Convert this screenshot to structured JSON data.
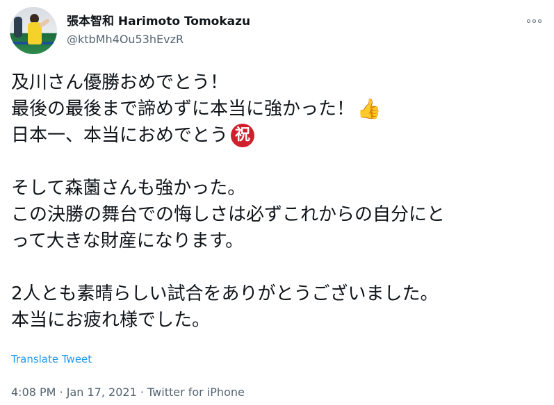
{
  "author": {
    "name": "張本智和 Harimoto Tomokazu",
    "handle": "@ktbMh4Ou53hEvzR"
  },
  "tweet": {
    "lines": [
      "及川さん優勝おめでとう！",
      "最後の最後まで諦めずに本当に強かった！",
      "日本一、本当におめでとう",
      "",
      "そして森薗さんも強かった。",
      "この決勝の舞台での悔しさは必ずこれからの自分にと",
      "って大きな財産になります。",
      "",
      "2人とも素晴らしい試合をありがとうございました。",
      "本当にお疲れ様でした。"
    ],
    "emoji": {
      "thumbs_up": "👍",
      "celebration": "祝"
    },
    "colors": {
      "thumbs_up": "#f7c33a",
      "celebration_bg": "#d0202e"
    }
  },
  "translate_label": "Translate Tweet",
  "meta": {
    "time": "4:08 PM",
    "separator": "·",
    "date": "Jan 17, 2021",
    "source": "Twitter for iPhone"
  },
  "icons": {
    "more": "more-horizontal-icon",
    "avatar": "profile-avatar"
  },
  "colors": {
    "text": "#0f1419",
    "secondary": "#536471",
    "link": "#1d9bf0"
  }
}
